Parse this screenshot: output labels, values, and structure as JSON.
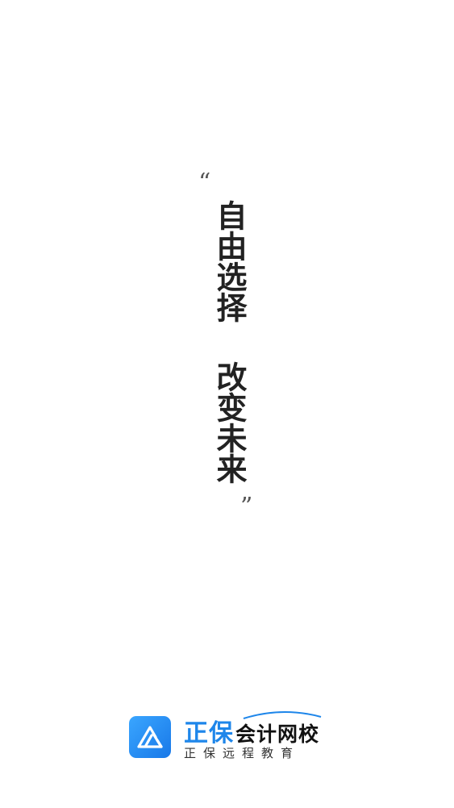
{
  "slogan": {
    "open_quote": "“",
    "close_quote": "”",
    "line1": "自由选择",
    "line2": "改变未来"
  },
  "brand": {
    "name_blue": "正保",
    "name_dark": "会计网校",
    "tagline": "正保远程教育",
    "icon": "zhengbao-logo-icon",
    "colors": {
      "brand_blue": "#1e86ea",
      "icon_gradient_start": "#3aa6ff",
      "icon_gradient_end": "#1878e8",
      "text_dark": "#111111"
    }
  }
}
